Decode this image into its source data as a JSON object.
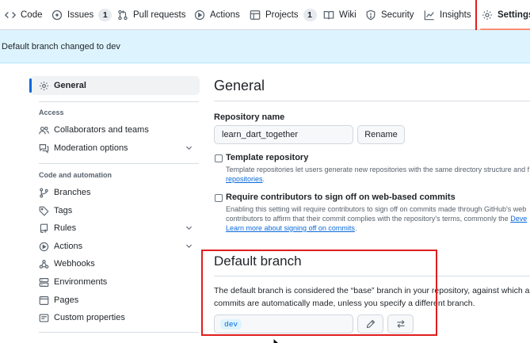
{
  "nav": {
    "tabs": [
      {
        "label": "Code",
        "icon": "code-icon"
      },
      {
        "label": "Issues",
        "icon": "issue-opened-icon",
        "count": "1"
      },
      {
        "label": "Pull requests",
        "icon": "git-pull-request-icon"
      },
      {
        "label": "Actions",
        "icon": "play-icon"
      },
      {
        "label": "Projects",
        "icon": "table-icon",
        "count": "1"
      },
      {
        "label": "Wiki",
        "icon": "book-icon"
      },
      {
        "label": "Security",
        "icon": "shield-icon"
      },
      {
        "label": "Insights",
        "icon": "graph-icon"
      },
      {
        "label": "Settings",
        "icon": "gear-icon",
        "selected": true
      }
    ]
  },
  "flash": {
    "message": "Default branch changed to dev"
  },
  "sidebar": {
    "general": "General",
    "access_heading": "Access",
    "access_items": [
      "Collaborators and teams",
      "Moderation options"
    ],
    "automation_heading": "Code and automation",
    "automation_items": [
      "Branches",
      "Tags",
      "Rules",
      "Actions",
      "Webhooks",
      "Environments",
      "Pages",
      "Custom properties"
    ]
  },
  "main": {
    "title": "General",
    "repo_name_label": "Repository name",
    "repo_name_value": "learn_dart_together",
    "rename_button": "Rename",
    "template": {
      "title": "Template repository",
      "desc_line1": "Template repositories let users generate new repositories with the same directory structure and f",
      "desc_link": "repositories"
    },
    "signoff": {
      "title": "Require contributors to sign off on web-based commits",
      "desc_line1": "Enabling this setting will require contributors to sign off on commits made through GitHub's web",
      "desc_line2": "contributors to affirm that their commit complies with the repository's terms, commonly the",
      "desc_line2_link": "Deve",
      "desc_link": "Learn more about signing off on commits"
    },
    "default_branch": {
      "title": "Default branch",
      "desc_line1": "The default branch is considered the “base” branch in your repository, against which all",
      "desc_line2": "commits are automatically made, unless you specify a different branch.",
      "branch": "dev"
    }
  },
  "colors": {
    "accent": "#0969da",
    "flash_bg": "#ddf4ff",
    "annotation": "#e01e1e",
    "selected_tab_underline": "#fd8c73"
  }
}
